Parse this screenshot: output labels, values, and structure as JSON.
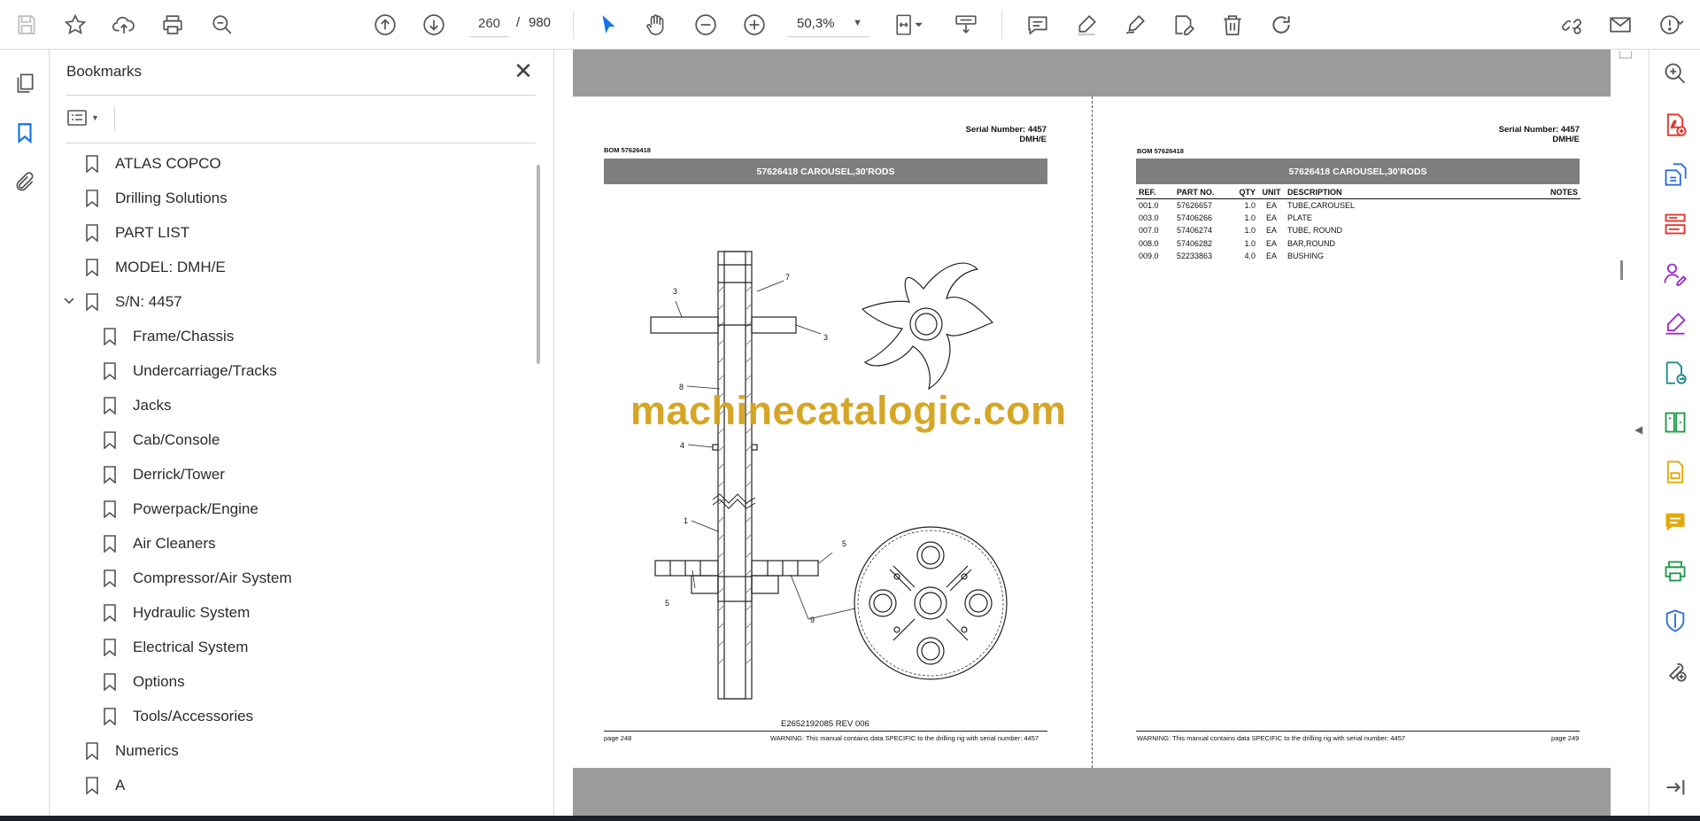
{
  "toolbar": {
    "page_current": "260",
    "page_separator": "/",
    "page_total": "980",
    "zoom": "50,3%",
    "icons": [
      "save-icon",
      "bookmark-star-icon",
      "upload-icon",
      "print-icon",
      "zoom-search-icon",
      "prev-page-icon",
      "next-page-icon",
      "select-cursor-icon",
      "hand-tool-icon",
      "zoom-out-icon",
      "zoom-in-icon",
      "fit-page-icon",
      "scroll-mode-icon",
      "comment-icon",
      "highlight-icon",
      "draw-icon",
      "fill-sign-icon",
      "delete-icon",
      "rotate-icon",
      "share-link-icon",
      "email-icon",
      "account-icon"
    ]
  },
  "bookmarks": {
    "title": "Bookmarks",
    "items": [
      {
        "label": "ATLAS COPCO",
        "level": 0
      },
      {
        "label": "Drilling Solutions",
        "level": 0
      },
      {
        "label": "PART LIST",
        "level": 0
      },
      {
        "label": "MODEL: DMH/E",
        "level": 0
      },
      {
        "label": "S/N: 4457",
        "level": 0,
        "expanded": true
      },
      {
        "label": "Frame/Chassis",
        "level": 1
      },
      {
        "label": "Undercarriage/Tracks",
        "level": 1
      },
      {
        "label": "Jacks",
        "level": 1
      },
      {
        "label": "Cab/Console",
        "level": 1
      },
      {
        "label": "Derrick/Tower",
        "level": 1
      },
      {
        "label": "Powerpack/Engine",
        "level": 1
      },
      {
        "label": "Air Cleaners",
        "level": 1
      },
      {
        "label": "Compressor/Air System",
        "level": 1
      },
      {
        "label": "Hydraulic System",
        "level": 1
      },
      {
        "label": "Electrical System",
        "level": 1
      },
      {
        "label": "Options",
        "level": 1
      },
      {
        "label": "Tools/Accessories",
        "level": 1
      },
      {
        "label": "Numerics",
        "level": 0
      },
      {
        "label": "A",
        "level": 0
      }
    ]
  },
  "page_left": {
    "serial_line1": "Serial Number: 4457",
    "serial_line2": "DMH/E",
    "bom": "BOM 57626418",
    "band": "57626418 CAROUSEL,30'RODS",
    "doc_number": "E2652192085 REV 006",
    "footer_page": "page 248",
    "footer_warning": "WARNING:  This manual contains data SPECIFIC to the drilling rig with serial number: 4457",
    "callouts": [
      "3",
      "7",
      "3",
      "8",
      "4",
      "1",
      "5",
      "5",
      "9"
    ]
  },
  "page_right": {
    "serial_line1": "Serial Number: 4457",
    "serial_line2": "DMH/E",
    "bom": "BOM 57626418",
    "band": "57626418 CAROUSEL,30'RODS",
    "headers": {
      "ref": "REF.",
      "part": "PART NO.",
      "qty": "QTY",
      "unit": "UNIT",
      "desc": "DESCRIPTION",
      "notes": "NOTES"
    },
    "rows": [
      {
        "ref": "001.0",
        "part": "57626657",
        "qty": "1.0",
        "unit": "EA",
        "desc": "TUBE,CAROUSEL"
      },
      {
        "ref": "003.0",
        "part": "57406266",
        "qty": "1.0",
        "unit": "EA",
        "desc": "PLATE"
      },
      {
        "ref": "007.0",
        "part": "57406274",
        "qty": "1.0",
        "unit": "EA",
        "desc": "TUBE, ROUND"
      },
      {
        "ref": "008.0",
        "part": "57406282",
        "qty": "1.0",
        "unit": "EA",
        "desc": "BAR,ROUND"
      },
      {
        "ref": "009.0",
        "part": "52233863",
        "qty": "4.0",
        "unit": "EA",
        "desc": "BUSHING"
      }
    ],
    "footer_page": "page 249",
    "footer_warning": "WARNING:  This manual contains data SPECIFIC to the drilling rig with serial number: 4457"
  },
  "watermark": "machinecatalogic.com",
  "colors": {
    "accent": "#1473e6",
    "band": "#7e7e7e",
    "watermark": "#d4a21b",
    "page_gutter": "#9b9b9b"
  }
}
